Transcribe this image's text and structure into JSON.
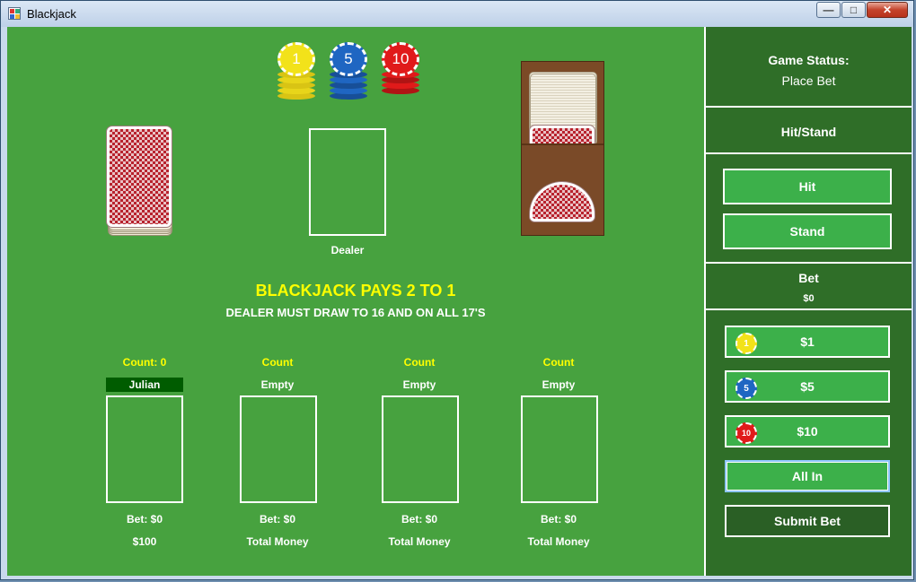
{
  "window": {
    "title": "Blackjack",
    "minimize": "—",
    "maximize": "□",
    "close": "✕"
  },
  "chips": [
    {
      "label": "1",
      "color": "#f2e21a"
    },
    {
      "label": "5",
      "color": "#1f66c2"
    },
    {
      "label": "10",
      "color": "#e01a1a"
    }
  ],
  "dealer": {
    "label": "Dealer"
  },
  "banner": {
    "main": "BLACKJACK PAYS 2 TO 1",
    "sub": "DEALER MUST DRAW TO 16 AND ON ALL 17'S"
  },
  "seats": [
    {
      "count": "Count: 0",
      "name": "Julian",
      "bet": "Bet: $0",
      "money": "$100"
    },
    {
      "count": "Count",
      "name": "Empty",
      "bet": "Bet: $0",
      "money": "Total Money"
    },
    {
      "count": "Count",
      "name": "Empty",
      "bet": "Bet: $0",
      "money": "Total Money"
    },
    {
      "count": "Count",
      "name": "Empty",
      "bet": "Bet: $0",
      "money": "Total Money"
    }
  ],
  "sidebar": {
    "status_label": "Game Status:",
    "status_value": "Place Bet",
    "hitstand_label": "Hit/Stand",
    "hit_button": "Hit",
    "stand_button": "Stand",
    "bet_label": "Bet",
    "bet_value": "$0",
    "bet_buttons": [
      {
        "label": "$1",
        "chip": "1",
        "color": "#f2e21a"
      },
      {
        "label": "$5",
        "chip": "5",
        "color": "#1f66c2"
      },
      {
        "label": "$10",
        "chip": "10",
        "color": "#e01a1a"
      }
    ],
    "all_in_button": "All In",
    "submit_button": "Submit Bet"
  }
}
